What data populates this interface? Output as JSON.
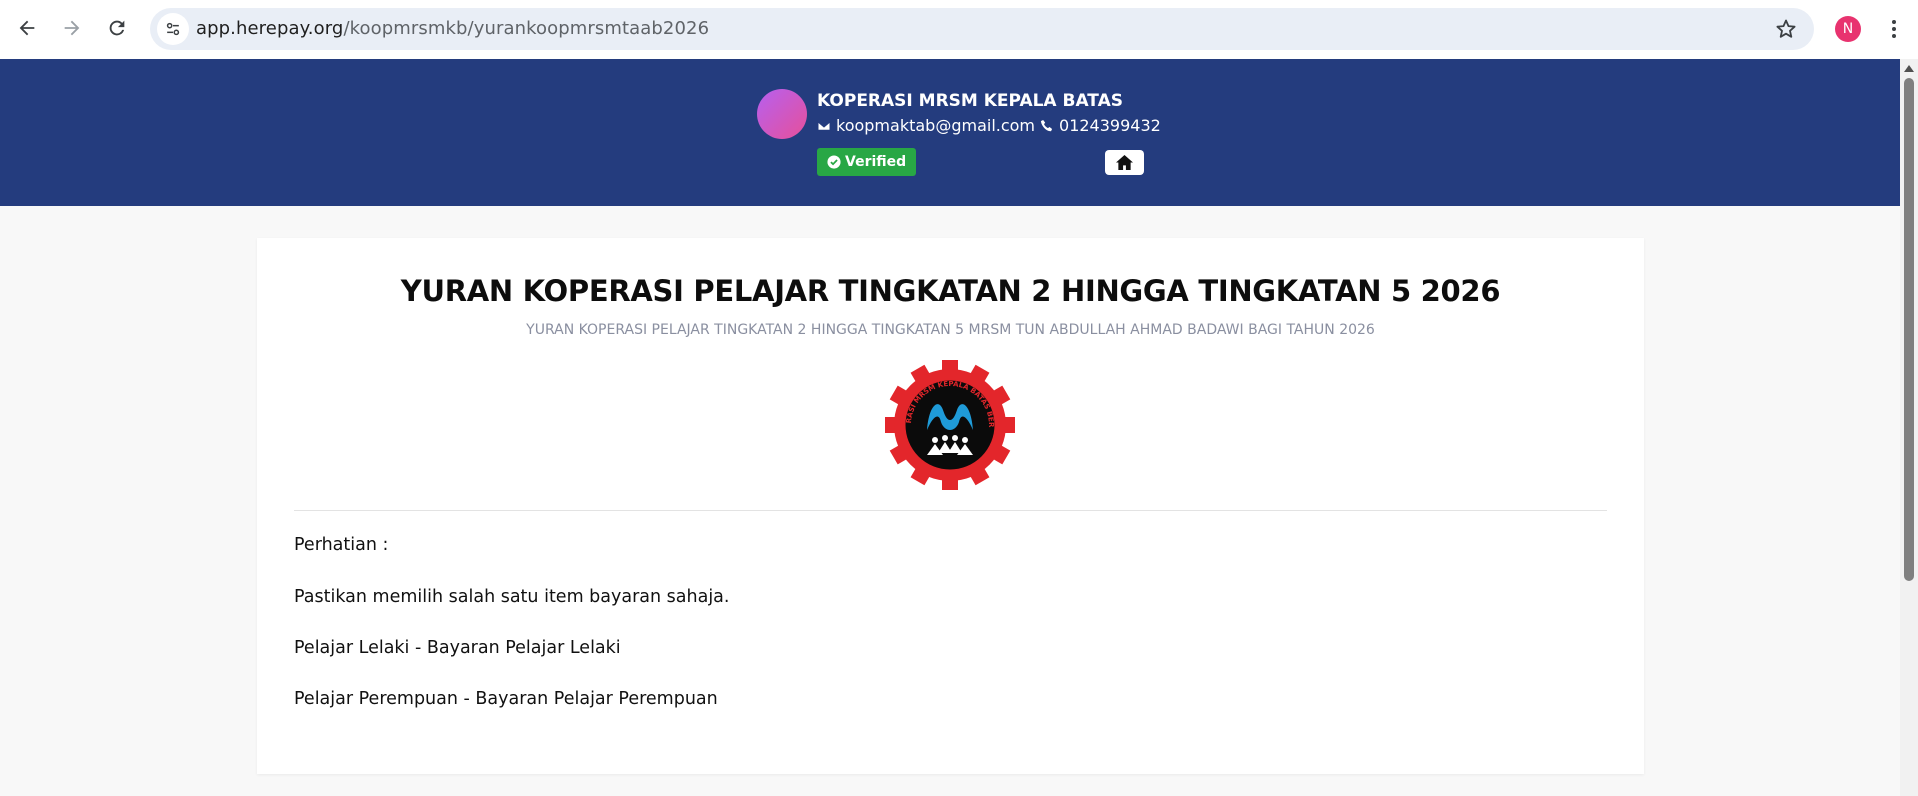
{
  "browser": {
    "url_host": "app.herepay.org",
    "url_path": "/koopmrsmkb/yurankoopmrsmtaab2026",
    "profile_initial": "N"
  },
  "header": {
    "org_name": "KOPERASI MRSM KEPALA BATAS",
    "email": "koopmaktab@gmail.com",
    "phone": "0124399432",
    "verified_label": "Verified"
  },
  "card": {
    "title": "YURAN KOPERASI PELAJAR TINGKATAN 2 HINGGA TINGKATAN 5 2026",
    "subtitle": "YURAN KOPERASI PELAJAR TINGKATAN 2 HINGGA TINGKATAN 5 MRSM TUN ABDULLAH AHMAD BADAWI BAGI TAHUN 2026",
    "logo_text": "KOPERASI MRSM KEPALA BATAS BERHAD",
    "notes": [
      "Perhatian :",
      "Pastikan memilih salah satu item bayaran sahaja.",
      "Pelajar Lelaki - Bayaran Pelajar Lelaki",
      "Pelajar Perempuan - Bayaran Pelajar Perempuan"
    ]
  },
  "colors": {
    "header_bg": "#243c7e",
    "verified_green": "#28a745",
    "logo_red": "#e3262b",
    "logo_blue": "#1f9bd8"
  }
}
